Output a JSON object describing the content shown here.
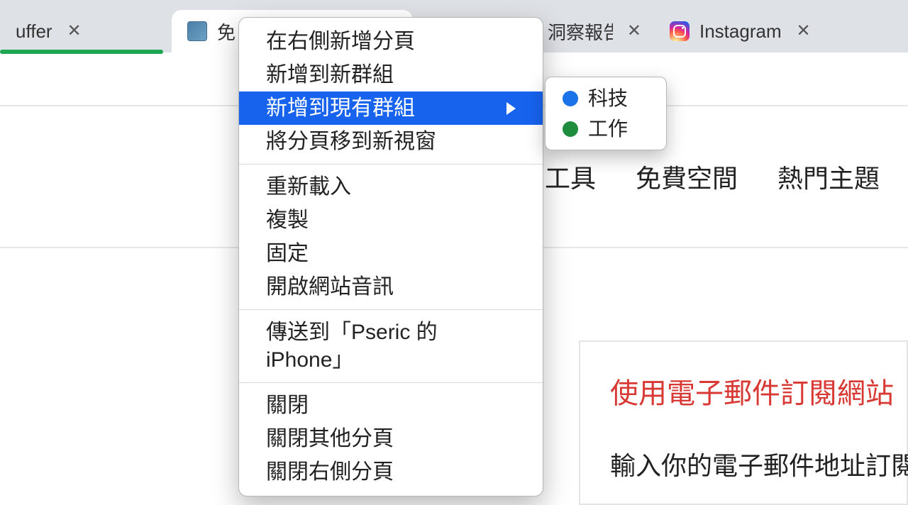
{
  "tabs": {
    "buffer": {
      "title_fragment": "uffer"
    },
    "free": {
      "title_fragment": "免"
    },
    "report": {
      "title_fragment": "洞察報告"
    },
    "instagram": {
      "title": "Instagram"
    }
  },
  "page_nav": {
    "link1": "工具",
    "link2": "免費空間",
    "link3": "熱門主題"
  },
  "sidebar": {
    "headline": "使用電子郵件訂閱網站",
    "sub": "輸入你的電子郵件地址訂閱"
  },
  "context_menu": {
    "items": [
      "在右側新增分頁",
      "新增到新群組",
      "新增到現有群組",
      "將分頁移到新視窗",
      "重新載入",
      "複製",
      "固定",
      "開啟網站音訊",
      "傳送到「Pseric 的 iPhone」",
      "關閉",
      "關閉其他分頁",
      "關閉右側分頁"
    ]
  },
  "submenu": {
    "groups": [
      {
        "label": "科技",
        "color": "blue"
      },
      {
        "label": "工作",
        "color": "green"
      }
    ]
  }
}
